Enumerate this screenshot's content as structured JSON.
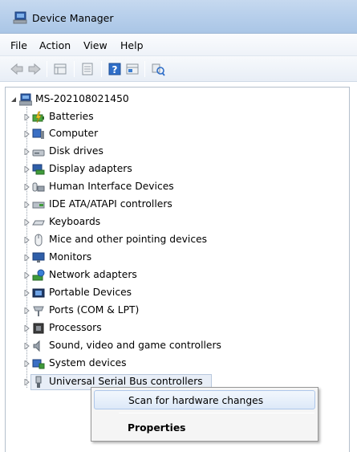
{
  "window": {
    "title": "Device Manager",
    "icon": "device-manager-icon"
  },
  "menu": [
    "File",
    "Action",
    "View",
    "Help"
  ],
  "toolbar": {
    "buttons": [
      "back-icon",
      "forward-icon",
      "properties-grid-icon",
      "document-icon",
      "help-icon",
      "view-icon",
      "scan-hardware-icon"
    ]
  },
  "tree": {
    "root": "MS-202108021450",
    "items": [
      {
        "label": "Batteries",
        "icon": "battery-icon"
      },
      {
        "label": "Computer",
        "icon": "computer-icon"
      },
      {
        "label": "Disk drives",
        "icon": "disk-drive-icon"
      },
      {
        "label": "Display adapters",
        "icon": "display-adapter-icon"
      },
      {
        "label": "Human Interface Devices",
        "icon": "hid-icon"
      },
      {
        "label": "IDE ATA/ATAPI controllers",
        "icon": "ide-controller-icon"
      },
      {
        "label": "Keyboards",
        "icon": "keyboard-icon"
      },
      {
        "label": "Mice and other pointing devices",
        "icon": "mouse-icon"
      },
      {
        "label": "Monitors",
        "icon": "monitor-icon"
      },
      {
        "label": "Network adapters",
        "icon": "network-adapter-icon"
      },
      {
        "label": "Portable Devices",
        "icon": "portable-device-icon"
      },
      {
        "label": "Ports (COM & LPT)",
        "icon": "port-icon"
      },
      {
        "label": "Processors",
        "icon": "processor-icon"
      },
      {
        "label": "Sound, video and game controllers",
        "icon": "sound-icon"
      },
      {
        "label": "System devices",
        "icon": "system-device-icon"
      },
      {
        "label": "Universal Serial Bus controllers",
        "icon": "usb-icon"
      }
    ]
  },
  "context_menu": {
    "items": [
      {
        "label": "Scan for hardware changes"
      },
      {
        "label": "Properties"
      }
    ]
  }
}
